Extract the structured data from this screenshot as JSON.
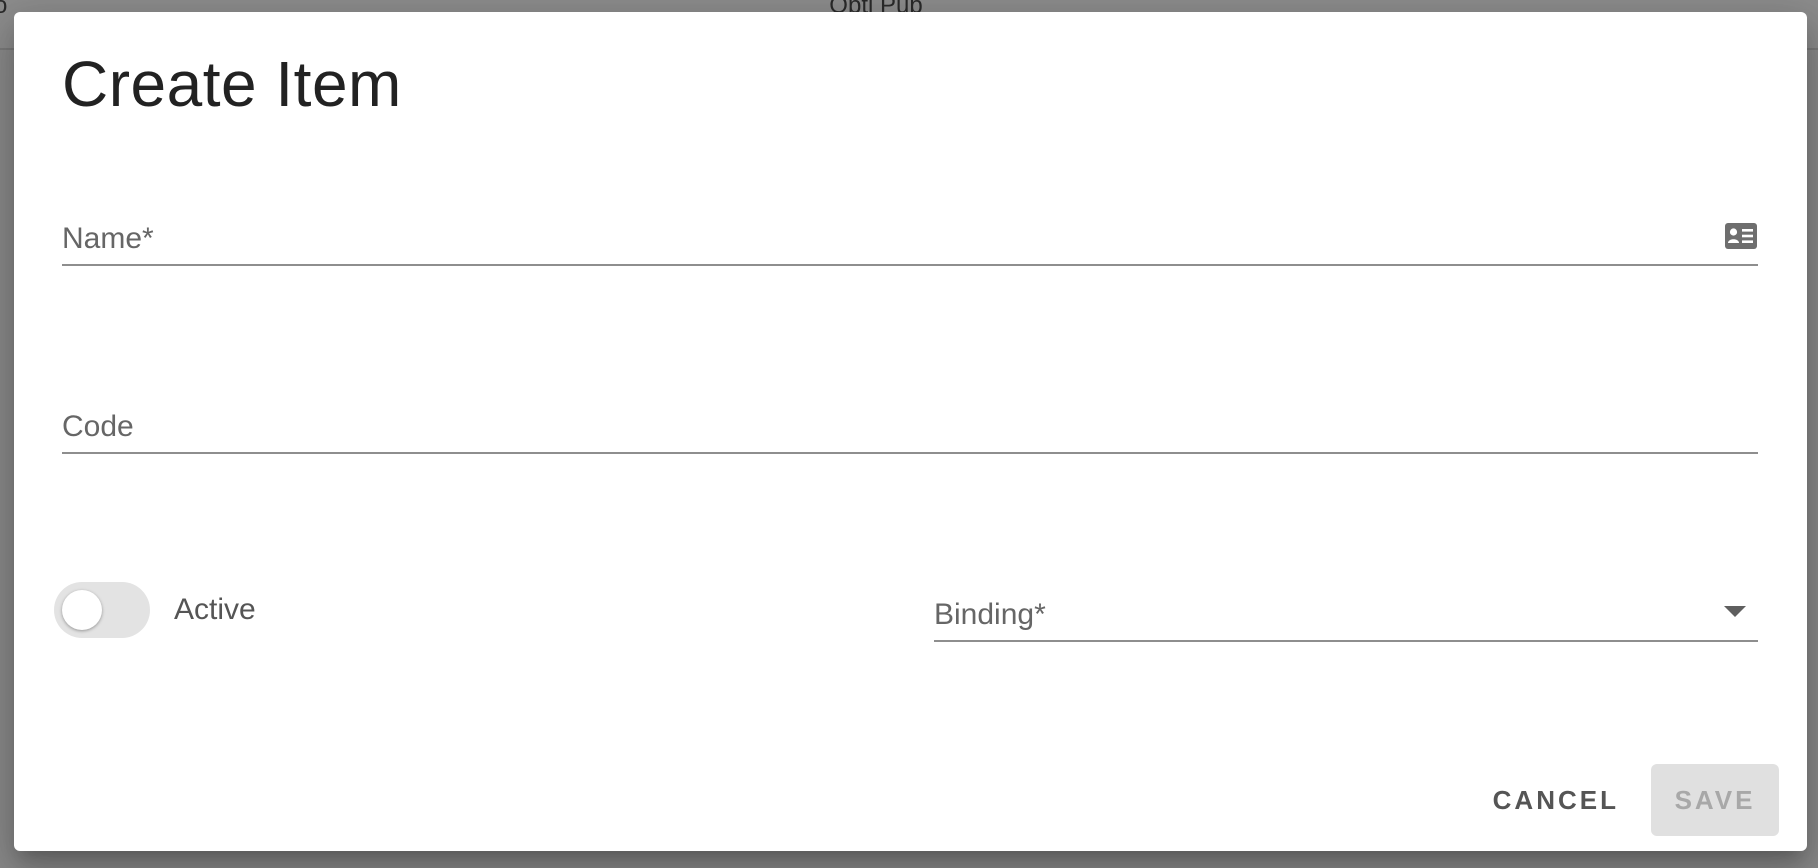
{
  "background": {
    "title": "Opti Pub",
    "edge_fragment": "o"
  },
  "dialog": {
    "title": "Create Item",
    "fields": {
      "name": {
        "label": "Name*",
        "value": "",
        "icon": "contact-card-icon"
      },
      "code": {
        "label": "Code",
        "value": ""
      },
      "binding": {
        "label": "Binding*",
        "value": "",
        "icon": "chevron-down-icon"
      }
    },
    "active_toggle": {
      "label": "Active",
      "checked": false
    },
    "actions": {
      "cancel_label": "CANCEL",
      "save_label": "SAVE",
      "save_disabled": true
    }
  },
  "colors": {
    "overlay": "#8a8a8a",
    "surface": "#ffffff",
    "label": "#666666",
    "underline": "#8e8e8e",
    "toggle_track": "#e3e3e3",
    "disabled_button_bg": "#e0e0e0",
    "disabled_button_text": "#a8a8a8"
  }
}
